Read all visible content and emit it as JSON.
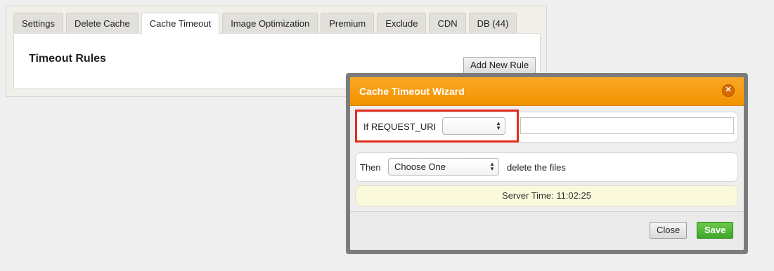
{
  "tabs": [
    {
      "label": "Settings",
      "active": false
    },
    {
      "label": "Delete Cache",
      "active": false
    },
    {
      "label": "Cache Timeout",
      "active": true
    },
    {
      "label": "Image Optimization",
      "active": false
    },
    {
      "label": "Premium",
      "active": false
    },
    {
      "label": "Exclude",
      "active": false
    },
    {
      "label": "CDN",
      "active": false
    },
    {
      "label": "DB (44)",
      "active": false
    }
  ],
  "main": {
    "title": "Timeout Rules",
    "add_rule_label": "Add New Rule"
  },
  "wizard": {
    "title": "Cache Timeout Wizard",
    "close_icon": "close-icon",
    "condition_label": "If REQUEST_URI",
    "condition_select_value": "",
    "condition_input_value": "",
    "action_label": "Then",
    "action_select_value": "Choose One",
    "action_suffix": "delete the files",
    "server_time": "Server Time: 11:02:25",
    "close_button_label": "Close",
    "save_button_label": "Save"
  },
  "colors": {
    "header_orange": "#f39200",
    "save_green": "#3fa62a",
    "highlight_red": "#e22d1e",
    "notice_bg": "#fbf9dc"
  }
}
